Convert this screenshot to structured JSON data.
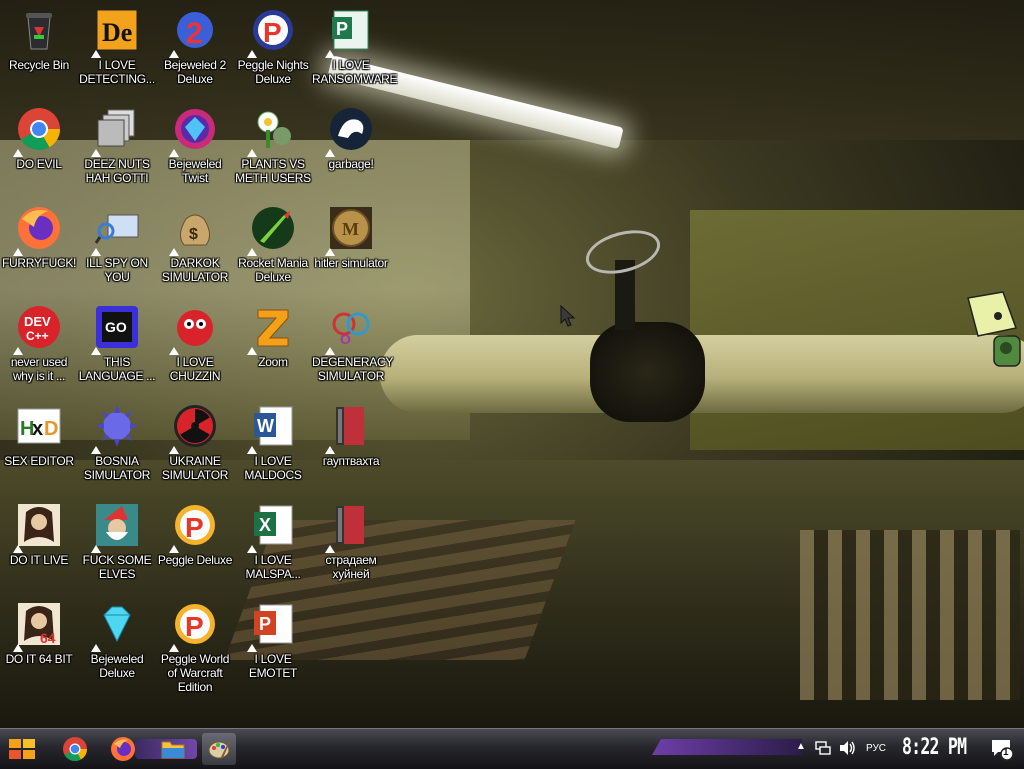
{
  "desktop": {
    "icons": [
      {
        "label": "Recycle Bin",
        "icon": "recycle-bin-icon",
        "shortcut": false
      },
      {
        "label": "I LOVE DETECTING...",
        "icon": "detect-it-easy-icon",
        "shortcut": true
      },
      {
        "label": "Bejeweled 2 Deluxe",
        "icon": "bejeweled-2-icon",
        "shortcut": true
      },
      {
        "label": "Peggle Nights Deluxe",
        "icon": "peggle-nights-icon",
        "shortcut": true
      },
      {
        "label": "I LOVE RANSOMWARE",
        "icon": "publisher-icon",
        "shortcut": true
      },
      {
        "label": "DO EVIL",
        "icon": "chrome-icon",
        "shortcut": true
      },
      {
        "label": "DEEZ NUTS HAH GOTTI",
        "icon": "windows-stack-icon",
        "shortcut": true
      },
      {
        "label": "Bejeweled Twist",
        "icon": "bejeweled-twist-icon",
        "shortcut": true
      },
      {
        "label": "PLANTS VS METH USERS",
        "icon": "plants-vs-zombies-icon",
        "shortcut": true
      },
      {
        "label": "garbage!",
        "icon": "dragon-icon",
        "shortcut": true
      },
      {
        "label": "FURRYFUCK!",
        "icon": "firefox-icon",
        "shortcut": true
      },
      {
        "label": "ILL SPY ON YOU",
        "icon": "spy-monitor-icon",
        "shortcut": true
      },
      {
        "label": "DARKOK SIMULATOR",
        "icon": "money-bag-icon",
        "shortcut": true
      },
      {
        "label": "Rocket Mania Deluxe",
        "icon": "rocket-mania-icon",
        "shortcut": true
      },
      {
        "label": "hitler simulator",
        "icon": "coin-icon",
        "shortcut": true
      },
      {
        "label": "never used why is it ...",
        "icon": "dev-cpp-icon",
        "shortcut": true
      },
      {
        "label": "THIS LANGUAGE ...",
        "icon": "goland-icon",
        "shortcut": true
      },
      {
        "label": "I LOVE CHUZZIN",
        "icon": "chuzzle-icon",
        "shortcut": true
      },
      {
        "label": "Zoom",
        "icon": "zuma-icon",
        "shortcut": true
      },
      {
        "label": "DEGENERACY SIMULATOR",
        "icon": "degeneracy-icon",
        "shortcut": true
      },
      {
        "label": "SEX EDITOR",
        "icon": "hxd-icon",
        "shortcut": false
      },
      {
        "label": "BOSNIA SIMULATOR",
        "icon": "spiked-ball-icon",
        "shortcut": true
      },
      {
        "label": "UKRAINE SIMULATOR",
        "icon": "radiation-icon",
        "shortcut": true
      },
      {
        "label": "I LOVE MALDOCS",
        "icon": "word-icon",
        "shortcut": true
      },
      {
        "label": "гауптвахта",
        "icon": "red-book-icon",
        "shortcut": true
      },
      {
        "label": "DO IT LIVE",
        "icon": "portrait-icon",
        "shortcut": true
      },
      {
        "label": "FUCK SOME ELVES",
        "icon": "santa-icon",
        "shortcut": true
      },
      {
        "label": "Peggle Deluxe",
        "icon": "peggle-icon",
        "shortcut": true
      },
      {
        "label": "I LOVE MALSPA...",
        "icon": "excel-icon",
        "shortcut": true
      },
      {
        "label": "страдаем хуйней",
        "icon": "red-book-icon",
        "shortcut": true
      },
      {
        "label": "DO IT 64 BIT",
        "icon": "portrait-64-icon",
        "shortcut": true
      },
      {
        "label": "Bejeweled Deluxe",
        "icon": "diamond-icon",
        "shortcut": true
      },
      {
        "label": "Peggle World of Warcraft Edition",
        "icon": "peggle-wow-icon",
        "shortcut": true
      },
      {
        "label": "I LOVE EMOTET",
        "icon": "powerpoint-icon",
        "shortcut": true
      }
    ]
  },
  "taskbar": {
    "start_icon": "start-logo-icon",
    "pinned": [
      "chrome-icon",
      "firefox-icon",
      "folder-icon",
      "paint-icon"
    ],
    "tray": {
      "language": "РУС",
      "time": "8:22 PM",
      "notification_count": "1"
    }
  },
  "colors": {
    "taskbar_accent": "#7a4ab8",
    "label_text": "#ffffff"
  }
}
